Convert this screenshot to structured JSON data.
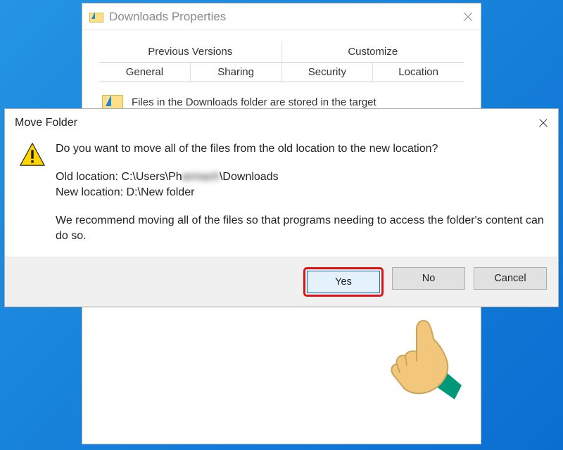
{
  "properties": {
    "title": "Downloads Properties",
    "tabs_row1": [
      "Previous Versions",
      "Customize"
    ],
    "tabs_row2": [
      "General",
      "Sharing",
      "Security",
      "Location"
    ],
    "active_tab": "Location",
    "desc": "Files in the Downloads folder are stored in the target"
  },
  "dialog": {
    "title": "Move Folder",
    "question": "Do you want to move all of the files from the old location to the new location?",
    "old_label": "Old location: C:\\Users\\Ph",
    "old_obscured": "armach",
    "old_suffix": "\\Downloads",
    "new_label": "New location: D:\\New folder",
    "recommend": "We recommend moving all of the files so that programs needing to access the folder's content can do so.",
    "buttons": {
      "yes": "Yes",
      "no": "No",
      "cancel": "Cancel"
    }
  }
}
